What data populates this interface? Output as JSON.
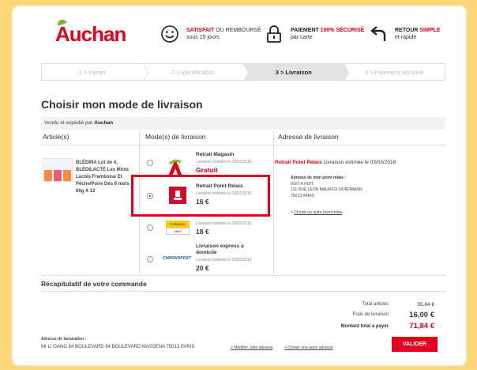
{
  "header": {
    "logo_text": "Auchan",
    "satisfaction": {
      "line1_red": "SATISFAIT",
      "line1_rest": " OU REMBOURSÉ",
      "line2": "sous 15 jours",
      "icon": "smiley-icon"
    },
    "payment": {
      "line1_black": "PAIEMENT ",
      "line1_red": "100% SÉCURISÉ",
      "line2": "par carte",
      "icon": "lock-icon"
    },
    "returns": {
      "line1_black": "RETOUR ",
      "line1_red": "SIMPLE",
      "line2": "et rapide",
      "icon": "return-arrow-icon"
    }
  },
  "steps": [
    {
      "label": "1 > Panier",
      "active": false
    },
    {
      "label": "2 > Identification",
      "active": false
    },
    {
      "label": "3 > Livraison",
      "active": true
    },
    {
      "label": "4 > Paiement sécurisé",
      "active": false
    }
  ],
  "page_title": "Choisir mon mode de livraison",
  "sold_by": {
    "prefix": "Vendu et expédié par ",
    "seller": "Auchan"
  },
  "columns": {
    "articles": "Article(s)",
    "modes": "Mode(s) de livraison",
    "address": "Adresse de livraison"
  },
  "product": {
    "name": "BLÉDINA Lot de 4, BLÉDILACTÉ Les Minis Lactés Framboise Et Pêche/Poire Dès 6 mois 60g X 12"
  },
  "delivery_options": [
    {
      "title": "Retrait Magasin",
      "estimate": "Livraison estimée le 03/03/2016",
      "price": "Gratuit",
      "icon": "auchan-store-icon",
      "selected": false
    },
    {
      "title": "Retrait Point Relais",
      "estimate": "Livraison estimée le 03/03/2016",
      "price": "16 €",
      "icon": "pickup-relay-icon",
      "selected": true
    },
    {
      "title": "",
      "estimate": "Livraison estimée le 03/03/2016",
      "price": "18 €",
      "icon": "colissimo-icon",
      "selected": false
    },
    {
      "title": "Livraison express à domicile",
      "estimate": "Livraison estimée le 02/03/2016",
      "price": "20 €",
      "icon": "chronopost-icon",
      "selected": false
    }
  ],
  "address": {
    "mode": "Retrait Point Relais",
    "estimate": " Livraison estimée le 03/03/2016",
    "header": "Adresse de mon point relais :",
    "lines": [
      "HUIT A HUIT",
      "131 RUE LEON MAURICE NORDMANN",
      "75013 PARIS"
    ],
    "change_link": "Choisir un autre point relais"
  },
  "recap": {
    "title": "Récapitulatif de votre commande",
    "total_articles_label": "Total articles",
    "total_articles_value": "55,84 €",
    "delivery_label": "Frais de livraison",
    "delivery_value": "16,00 €",
    "total_label": "Montant total à payer",
    "total_value": "71,84 €"
  },
  "billing": {
    "label": "Adresse de facturation :",
    "address": "Mr LI GANG 84 BOULEVARD 84 BOULEVARD MASSENA 75013 PARIS",
    "modify_link": "Modifier cette adresse",
    "choose_link": "Choisir une autre adresse"
  },
  "validate_label": "VALIDER",
  "colors": {
    "accent": "#e2001a",
    "green": "#7ab929",
    "background": "#fbd77a"
  }
}
